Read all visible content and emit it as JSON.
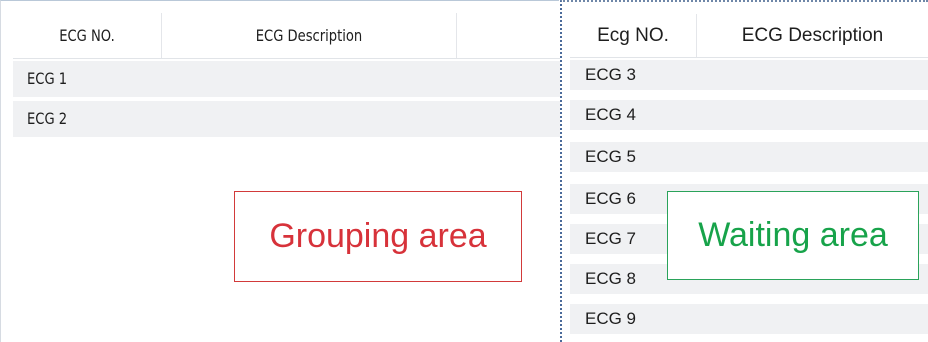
{
  "grouping_panel": {
    "columns": [
      {
        "label": "ECG NO."
      },
      {
        "label": "ECG Description"
      }
    ],
    "rows": [
      {
        "ecg_no": "ECG 1",
        "description": ""
      },
      {
        "ecg_no": "ECG 2",
        "description": ""
      }
    ]
  },
  "waiting_panel": {
    "columns": [
      {
        "label": "Ecg NO."
      },
      {
        "label": "ECG Description"
      }
    ],
    "rows": [
      {
        "ecg_no": "ECG 3",
        "description": ""
      },
      {
        "ecg_no": "ECG 4",
        "description": ""
      },
      {
        "ecg_no": "ECG 5",
        "description": ""
      },
      {
        "ecg_no": "ECG 6",
        "description": ""
      },
      {
        "ecg_no": "ECG 7",
        "description": ""
      },
      {
        "ecg_no": "ECG 8",
        "description": ""
      },
      {
        "ecg_no": "ECG 9",
        "description": ""
      }
    ]
  },
  "annotations": {
    "grouping_label": "Grouping area",
    "waiting_label": "Waiting area",
    "grouping_color": "#d7323a",
    "waiting_color": "#17a34a"
  }
}
